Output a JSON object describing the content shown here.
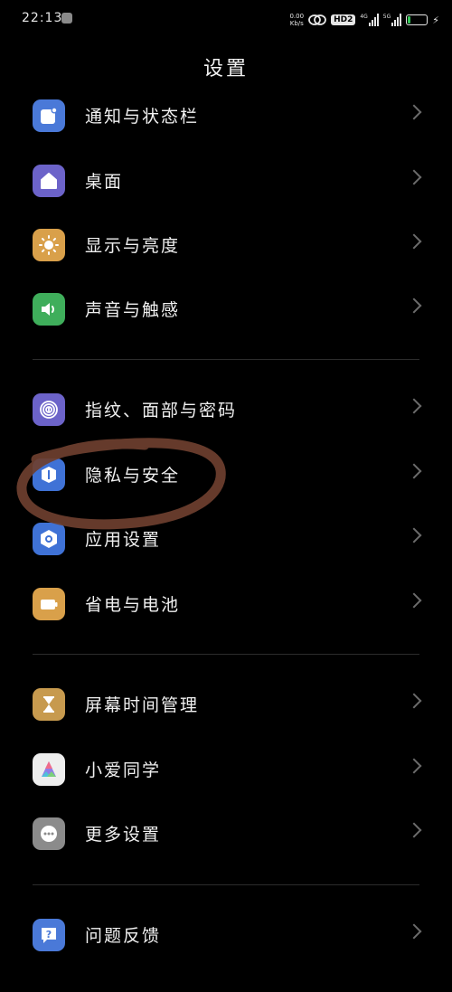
{
  "status_bar": {
    "time": "22:13",
    "speed_value": "0.00",
    "speed_unit": "Kb/s",
    "hd_label": "HD2",
    "net_4g": "4G",
    "net_5g": "5G",
    "battery_level": "14",
    "battery_fraction": 0.14,
    "charging_icon": "lightning-bolt-icon"
  },
  "page": {
    "title": "设置"
  },
  "groups": [
    {
      "items": [
        {
          "label": "通知与状态栏",
          "icon": "notification-icon",
          "color": "#4a79d8"
        },
        {
          "label": "桌面",
          "icon": "home-icon",
          "color": "#6c63c9"
        },
        {
          "label": "显示与亮度",
          "icon": "sun-icon",
          "color": "#d9a04a"
        },
        {
          "label": "声音与触感",
          "icon": "speaker-icon",
          "color": "#3fae5b"
        }
      ]
    },
    {
      "items": [
        {
          "label": "指纹、面部与密码",
          "icon": "fingerprint-icon",
          "color": "#6c63c9"
        },
        {
          "label": "隐私与安全",
          "icon": "shield-icon",
          "color": "#3f72d6"
        },
        {
          "label": "应用设置",
          "icon": "hexagon-gear-icon",
          "color": "#3f72d6"
        },
        {
          "label": "省电与电池",
          "icon": "battery-icon",
          "color": "#d9a04a"
        }
      ]
    },
    {
      "items": [
        {
          "label": "屏幕时间管理",
          "icon": "hourglass-icon",
          "color": "#c79a4e"
        },
        {
          "label": "小爱同学",
          "icon": "xiaoai-icon",
          "color": "#eeeeee"
        },
        {
          "label": "更多设置",
          "icon": "more-dots-icon",
          "color": "#8b8b8b"
        }
      ]
    },
    {
      "items": [
        {
          "label": "问题反馈",
          "icon": "feedback-question-icon",
          "color": "#4a79d8"
        }
      ]
    }
  ],
  "annotation": {
    "color": "#6e3f2f",
    "target": "隐私与安全"
  }
}
